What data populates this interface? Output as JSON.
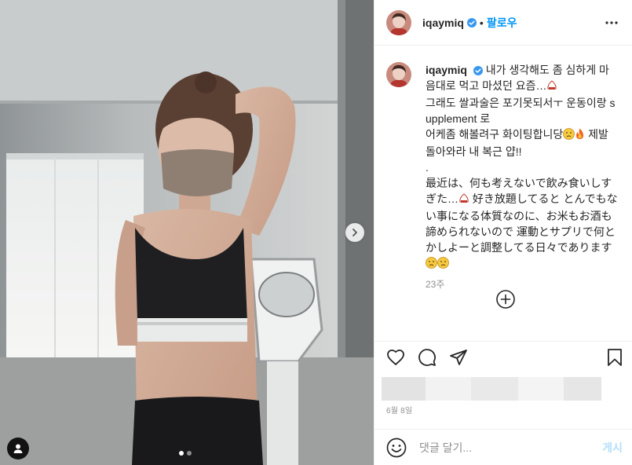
{
  "post": {
    "username": "iqaymiq",
    "follow_label": "팔로우",
    "separator": "•",
    "caption_lines": [
      "내가 생각해도 좀 심하게 마음대로 먹고 마셨던 요즘…",
      "그래도 쌀과술은 포기못되서ㅜ 운동이랑 supplement 로",
      "어케좀 해볼려구 화이팅합니당",
      "제발 돌아와라 내 복근 얍!!",
      ".",
      "最近は、何も考えないで飲み食いしすぎた…",
      "好き放題してると とんでもない事になる体質なのに、お米もお酒も諦められないので",
      "運動とサプリで何とかしよーと調整してる日々であります"
    ],
    "caption_time": "23주",
    "date": "6월 8일"
  },
  "comment_input": {
    "placeholder": "댓글 달기...",
    "post_label": "게시"
  },
  "carousel": {
    "slide_count": 2,
    "active_slide": 1
  },
  "icons": {
    "verified": "verified-badge-icon",
    "more": "more-options-icon",
    "like": "heart-icon",
    "comment": "comment-bubble-icon",
    "share": "paper-plane-icon",
    "save": "bookmark-icon",
    "emoji": "smiley-icon",
    "load_more": "plus-circle-icon",
    "next": "chevron-right-icon",
    "tag": "user-tag-icon"
  },
  "colors": {
    "accent": "#0095f6",
    "verified": "#3897f0",
    "muted_text": "#8e8e8e",
    "post_disabled": "#b2dffc"
  }
}
